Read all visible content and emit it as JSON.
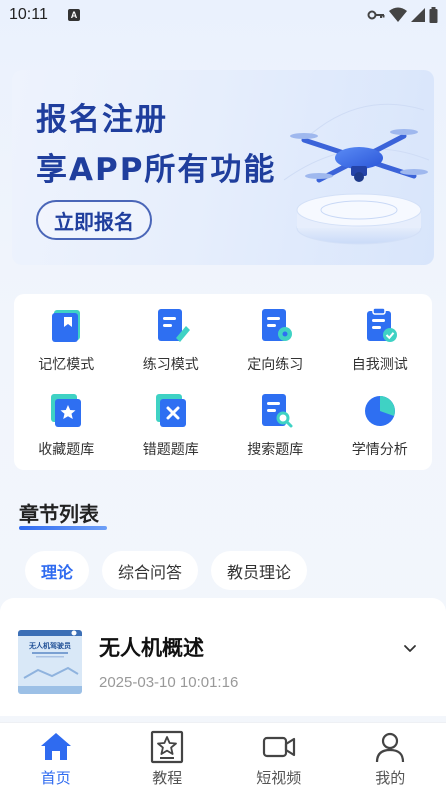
{
  "status": {
    "time": "10:11",
    "a_badge": "A"
  },
  "banner": {
    "title_line1": "报名注册",
    "title_line2": "享APP所有功能",
    "button": "立即报名"
  },
  "grid": [
    {
      "label": "记忆模式",
      "icon": "book-icon"
    },
    {
      "label": "练习模式",
      "icon": "edit-document-icon"
    },
    {
      "label": "定向练习",
      "icon": "target-document-icon"
    },
    {
      "label": "自我测试",
      "icon": "clipboard-check-icon"
    },
    {
      "label": "收藏题库",
      "icon": "star-document-icon"
    },
    {
      "label": "错题题库",
      "icon": "wrong-document-icon"
    },
    {
      "label": "搜索题库",
      "icon": "search-document-icon"
    },
    {
      "label": "学情分析",
      "icon": "pie-chart-icon"
    }
  ],
  "section": {
    "title": "章节列表"
  },
  "tabs": [
    "理论",
    "综合问答",
    "教员理论"
  ],
  "chapter": {
    "title": "无人机概述",
    "time": "2025-03-10 10:01:16",
    "thumb_text": "无人机驾驶员"
  },
  "nav": [
    {
      "label": "首页",
      "icon": "home-icon"
    },
    {
      "label": "教程",
      "icon": "tutorial-star-icon"
    },
    {
      "label": "短视频",
      "icon": "video-icon"
    },
    {
      "label": "我的",
      "icon": "user-icon"
    }
  ],
  "colors": {
    "accent": "#2f6bf0",
    "teal": "#3fd2c4",
    "blue": "#2e6ff2",
    "banner_text": "#1f3e9d"
  }
}
